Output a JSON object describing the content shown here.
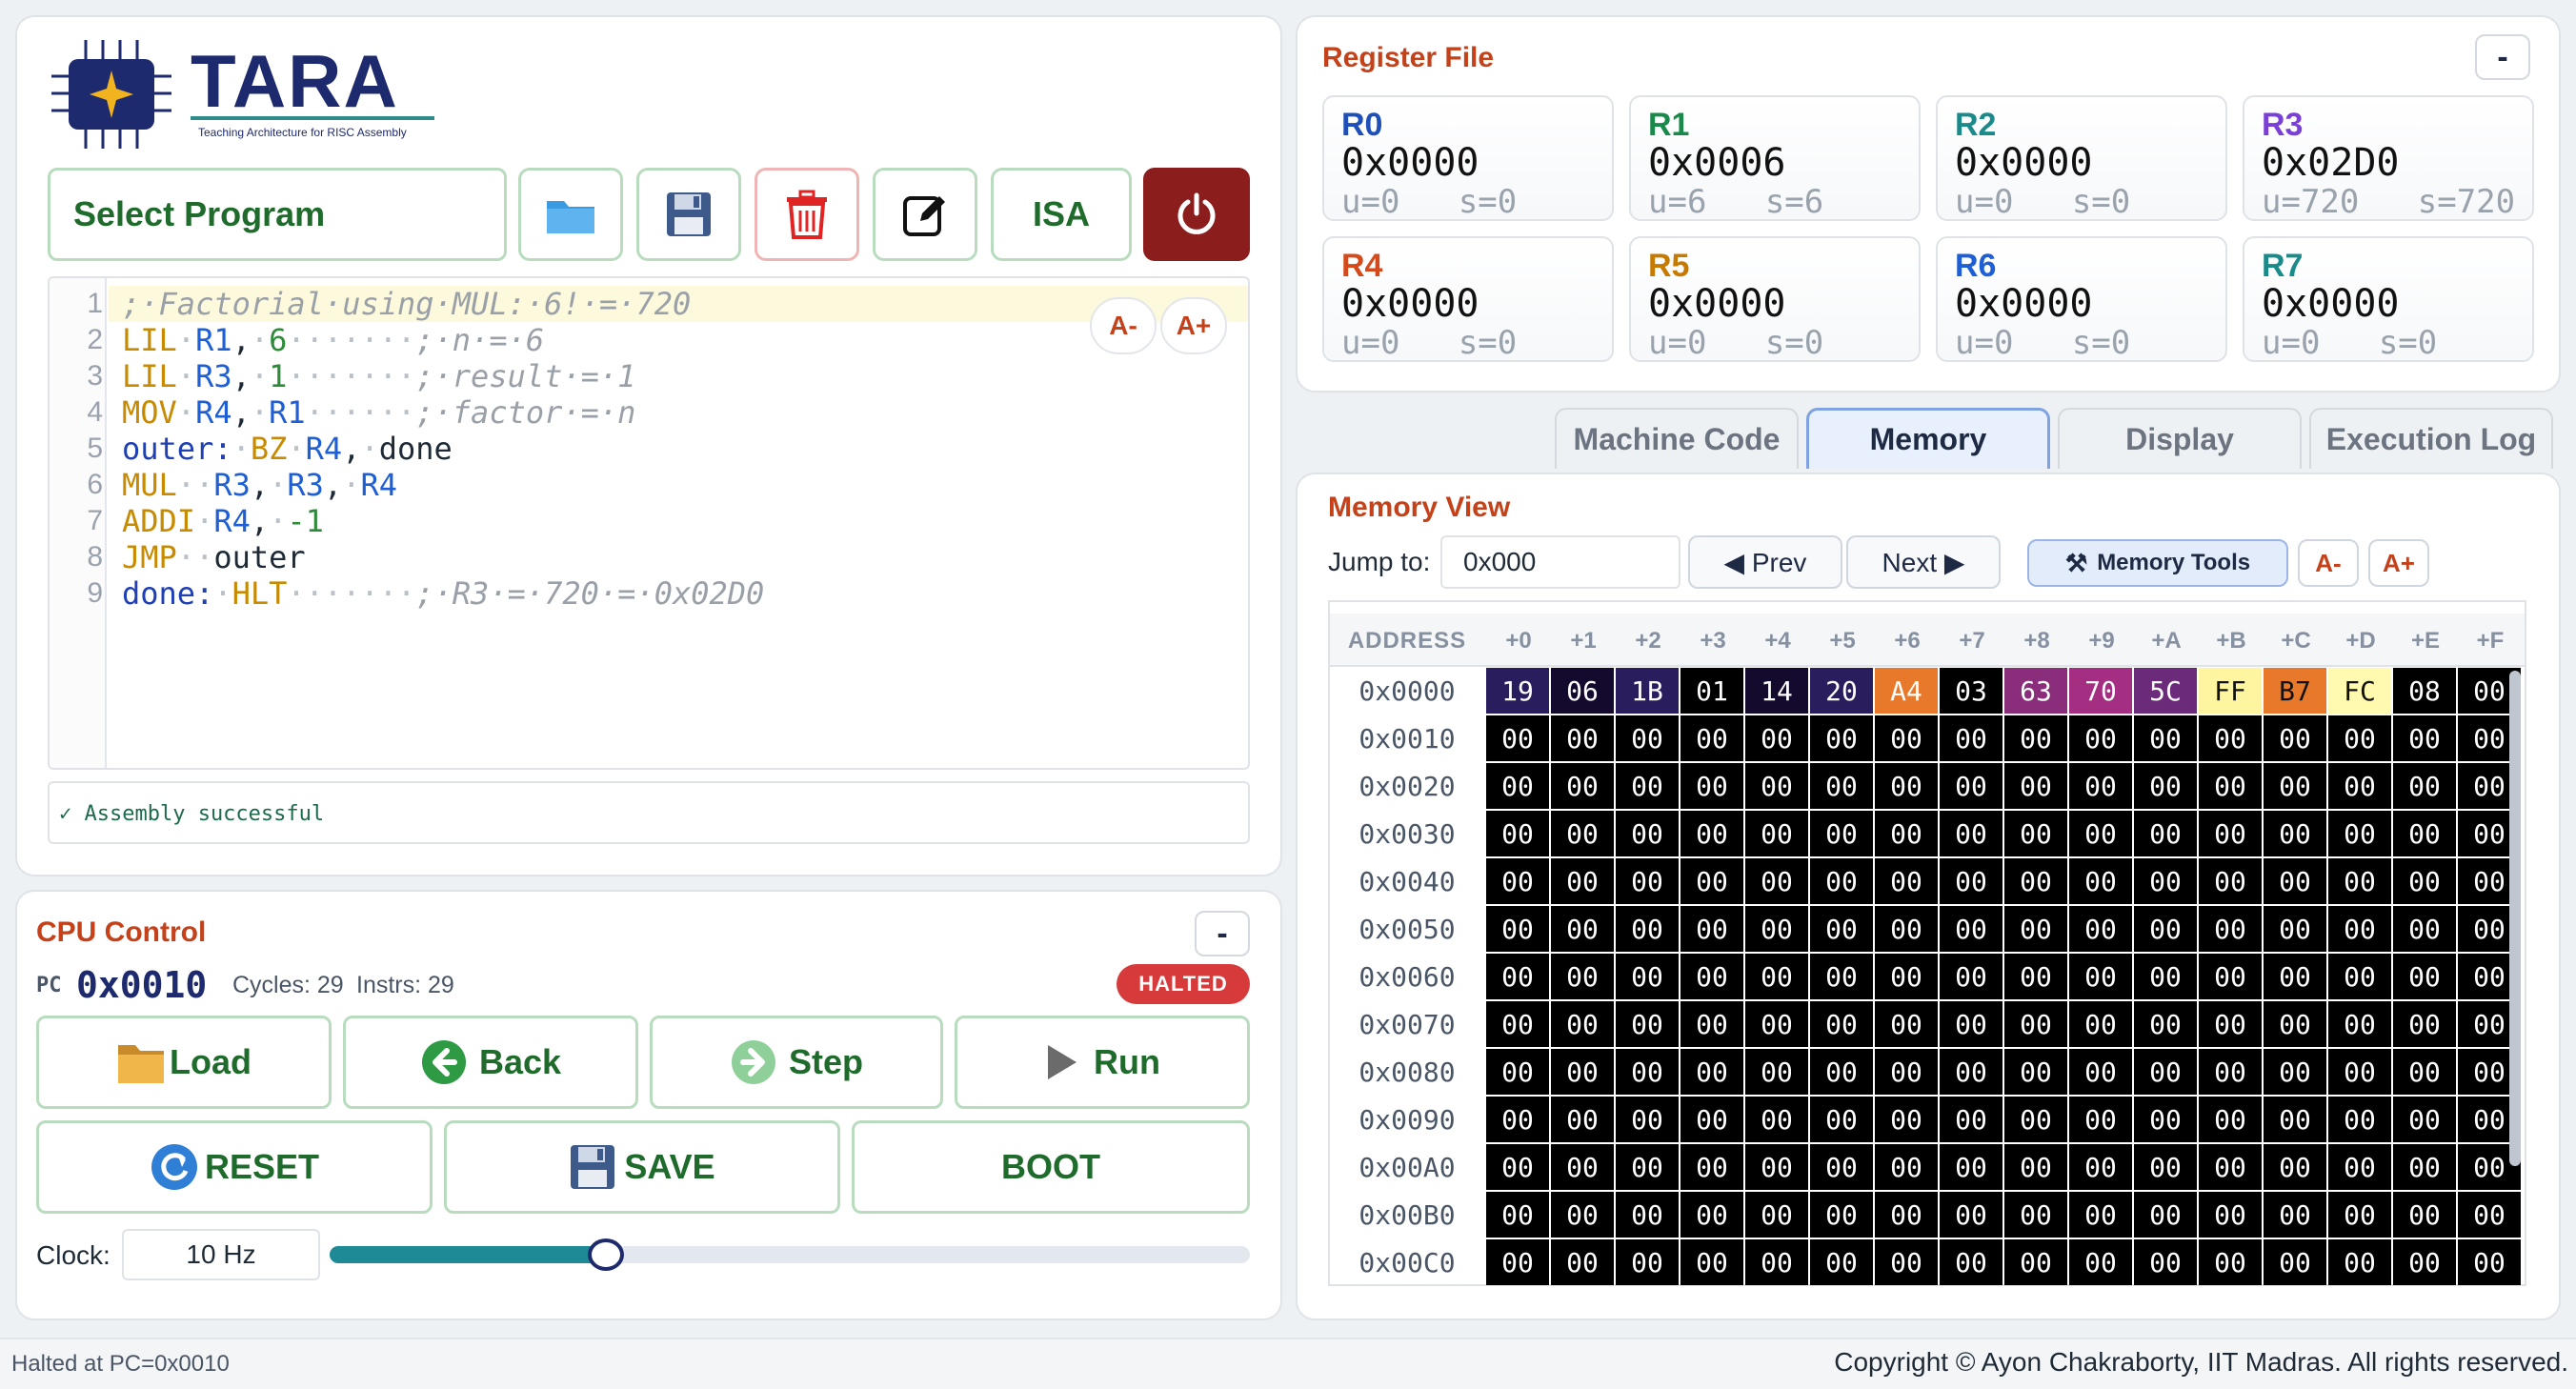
{
  "logo": {
    "title": "TARA",
    "tagline": "Teaching Architecture for RISC Assembly"
  },
  "toolbar": {
    "select_program": "Select Program",
    "isa_label": "ISA"
  },
  "editor": {
    "font_minus": "A-",
    "font_plus": "A+",
    "line_numbers": [
      "1",
      "2",
      "3",
      "4",
      "5",
      "6",
      "7",
      "8",
      "9"
    ],
    "status": "✓ Assembly successful"
  },
  "cpu": {
    "title": "CPU Control",
    "collapse": "-",
    "pc_label": "PC",
    "pc_value": "0x0010",
    "cycles": "Cycles: 29",
    "instrs": "Instrs: 29",
    "state_badge": "HALTED",
    "buttons": {
      "load": "Load",
      "back": "Back",
      "step": "Step",
      "run": "Run",
      "reset": "RESET",
      "save": "SAVE",
      "boot": "BOOT"
    },
    "clock_label": "Clock:",
    "clock_value": "10 Hz",
    "clock_slider_fraction": 0.3
  },
  "registers": {
    "title": "Register File",
    "collapse": "-",
    "items": [
      {
        "name": "R0",
        "value": "0x0000",
        "us": "u=0   s=0",
        "color": "#1f4fb8"
      },
      {
        "name": "R1",
        "value": "0x0006",
        "us": "u=6   s=6",
        "color": "#1a8a4a"
      },
      {
        "name": "R2",
        "value": "0x0000",
        "us": "u=0   s=0",
        "color": "#1b8a8a"
      },
      {
        "name": "R3",
        "value": "0x02D0",
        "us": "u=720   s=720",
        "color": "#7a3fd6"
      },
      {
        "name": "R4",
        "value": "0x0000",
        "us": "u=0   s=0",
        "color": "#d44a1a"
      },
      {
        "name": "R5",
        "value": "0x0000",
        "us": "u=0   s=0",
        "color": "#c77a00"
      },
      {
        "name": "R6",
        "value": "0x0000",
        "us": "u=0   s=0",
        "color": "#1f5fd6"
      },
      {
        "name": "R7",
        "value": "0x0000",
        "us": "u=0   s=0",
        "color": "#1b8a8a"
      }
    ]
  },
  "tabs": [
    {
      "label": "Machine Code"
    },
    {
      "label": "Memory"
    },
    {
      "label": "Display"
    },
    {
      "label": "Execution Log"
    }
  ],
  "memory": {
    "title": "Memory View",
    "jump_label": "Jump to:",
    "jump_value": "0x000",
    "prev": "◀ Prev",
    "next": "Next ▶",
    "tools": "Memory Tools",
    "font_minus": "A-",
    "font_plus": "A+",
    "address_header": "ADDRESS",
    "offsets": [
      "+0",
      "+1",
      "+2",
      "+3",
      "+4",
      "+5",
      "+6",
      "+7",
      "+8",
      "+9",
      "+A",
      "+B",
      "+C",
      "+D",
      "+E",
      "+F"
    ],
    "first_row": [
      "19",
      "06",
      "1B",
      "01",
      "14",
      "20",
      "A4",
      "03",
      "63",
      "70",
      "5C",
      "FF",
      "B7",
      "FC",
      "08",
      "00"
    ],
    "first_row_colors": [
      "#2a1d5e",
      "#140a2e",
      "#2a1d5e",
      "#000000",
      "#140a2e",
      "#2a1d5e",
      "#e8792a",
      "#000000",
      "#8a2d7a",
      "#a32e82",
      "#6b2a7a",
      "#fff5a0",
      "#e8792a",
      "#fffab0",
      "#000000",
      "#000000"
    ],
    "first_row_text": [
      "#fff",
      "#fff",
      "#fff",
      "#fff",
      "#fff",
      "#fff",
      "#fff",
      "#fff",
      "#fff",
      "#fff",
      "#fff",
      "#111",
      "#111",
      "#111",
      "#fff",
      "#fff"
    ],
    "addresses": [
      "0x0000",
      "0x0010",
      "0x0020",
      "0x0030",
      "0x0040",
      "0x0050",
      "0x0060",
      "0x0070",
      "0x0080",
      "0x0090",
      "0x00A0",
      "0x00B0",
      "0x00C0"
    ],
    "fill_value": "00"
  },
  "footer": {
    "status": "Halted at PC=0x0010",
    "copyright": "Copyright © Ayon Chakraborty, IIT Madras. All rights reserved."
  }
}
